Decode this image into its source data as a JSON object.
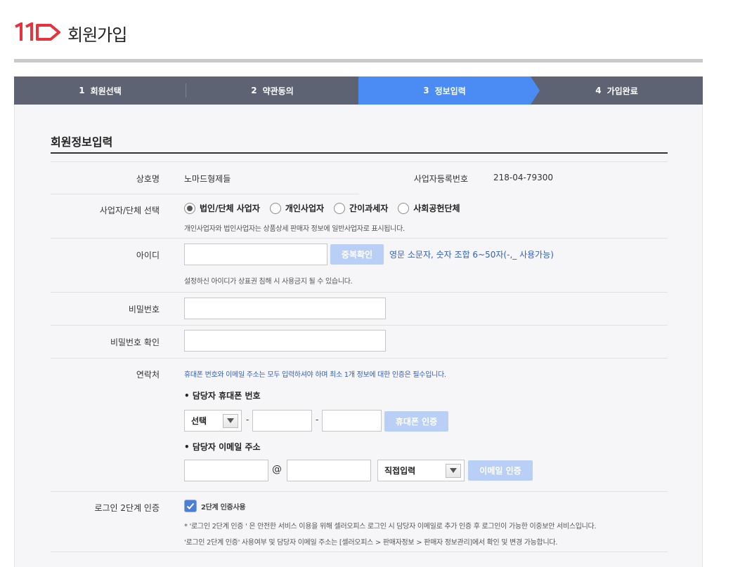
{
  "header": {
    "logo_text": "11",
    "title": "회원가입"
  },
  "steps": [
    {
      "num": "1",
      "label": "회원선택",
      "active": false
    },
    {
      "num": "2",
      "label": "약관동의",
      "active": false
    },
    {
      "num": "3",
      "label": "정보입력",
      "active": true
    },
    {
      "num": "4",
      "label": "가입완료",
      "active": false
    }
  ],
  "form": {
    "section_title": "회원정보입력",
    "company": {
      "label": "상호명",
      "value": "노마드형제들",
      "biz_label": "사업자등록번호",
      "biz_value": "218-04-79300"
    },
    "biz_type": {
      "label": "사업자/단체 선택",
      "options": [
        "법인/단체 사업자",
        "개인사업자",
        "간이과세자",
        "사회공헌단체"
      ],
      "selected_index": 0,
      "help": "개인사업자와 법인사업자는 상품상세 판매자 정보에 일반사업자로 표시됩니다."
    },
    "user_id": {
      "label": "아이디",
      "value": "",
      "check_button": "중복확인",
      "rule": "영문 소문자, 숫자 조합 6~50자(-,_ 사용가능)",
      "help": "설정하신 아이디가 상표권 침해 시 사용금지 될 수 있습니다."
    },
    "password": {
      "label": "비밀번호",
      "value": ""
    },
    "password_confirm": {
      "label": "비밀번호 확인",
      "value": ""
    },
    "contact": {
      "label": "연락처",
      "notice": "휴대폰 번호와 이메일 주소는 모두 입력하셔야 하며 최소 1개 정보에 대한 인증은 필수입니다.",
      "phone_title": "• 담당자 휴대폰 번호",
      "phone_prefix": "선택",
      "dash": "-",
      "phone_verify": "휴대폰 인증",
      "email_title": "• 담당자 이메일 주소",
      "at": "@",
      "email_domain": "직접입력",
      "email_verify": "이메일 인증"
    },
    "two_factor": {
      "label": "로그인 2단계 인증",
      "checkbox_label": "2단계 인증사용",
      "checked": true,
      "note1": "* '로그인 2단계 인증 ' 은 안전한 서비스 이용을 위해 셀러오피스 로그인 시 담당자 이메일로 추가 인증 후 로그인이 가능한 이중보안 서비스입니다.",
      "note2": "'로그인 2단계 인증' 사용여부 및 담당자 이메일 주소는 [셀러오피스 > 판매자정보 > 판매자 정보관리]에서 확인 및 변경 가능합니다."
    }
  },
  "colors": {
    "brand_red": "#e8323c",
    "step_bg": "#5d6373",
    "step_active": "#4a8bf4",
    "link_blue": "#2f5fbf",
    "disabled_button": "#b9cff5"
  }
}
